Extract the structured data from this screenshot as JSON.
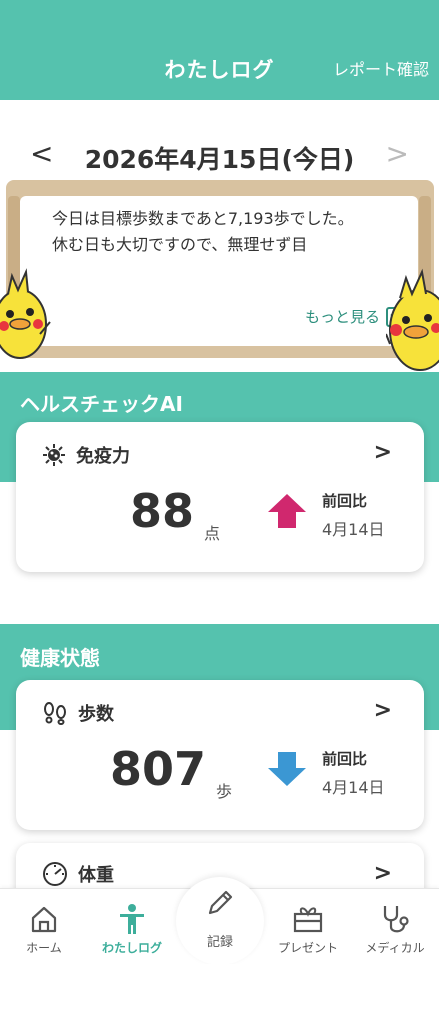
{
  "header": {
    "title": "わたしログ",
    "report_link": "レポート確認"
  },
  "date_nav": {
    "prev": "<",
    "date": "2026年4月15日(今日)",
    "next": ">"
  },
  "message": {
    "text": "今日は目標歩数まであと7,193歩でした。\n休む日も大切ですので、無理せず目",
    "more": "もっと見る"
  },
  "health_check": {
    "section_title": "ヘルスチェックAI",
    "card": {
      "label": "免疫力",
      "value": "88",
      "unit": "点",
      "compare_label": "前回比",
      "compare_date": "4月14日",
      "trend": "up",
      "trend_color": "#d0286e"
    }
  },
  "health_status": {
    "section_title": "健康状態",
    "steps_card": {
      "label": "歩数",
      "value": "807",
      "unit": "歩",
      "compare_label": "前回比",
      "compare_date": "4月14日",
      "trend": "down",
      "trend_color": "#3b97d3"
    },
    "weight_card": {
      "label": "体重"
    }
  },
  "nav": {
    "items": [
      {
        "label": "ホーム",
        "icon": "home-icon"
      },
      {
        "label": "わたしログ",
        "icon": "person-icon",
        "active": true
      },
      {
        "label": "記録",
        "icon": "pencil-icon"
      },
      {
        "label": "プレゼント",
        "icon": "gift-icon"
      },
      {
        "label": "メディカル",
        "icon": "stethoscope-icon"
      }
    ]
  },
  "colors": {
    "accent": "#55c2ae",
    "accent_text": "#3dae9b",
    "board_wood": "#d8c2a0"
  }
}
